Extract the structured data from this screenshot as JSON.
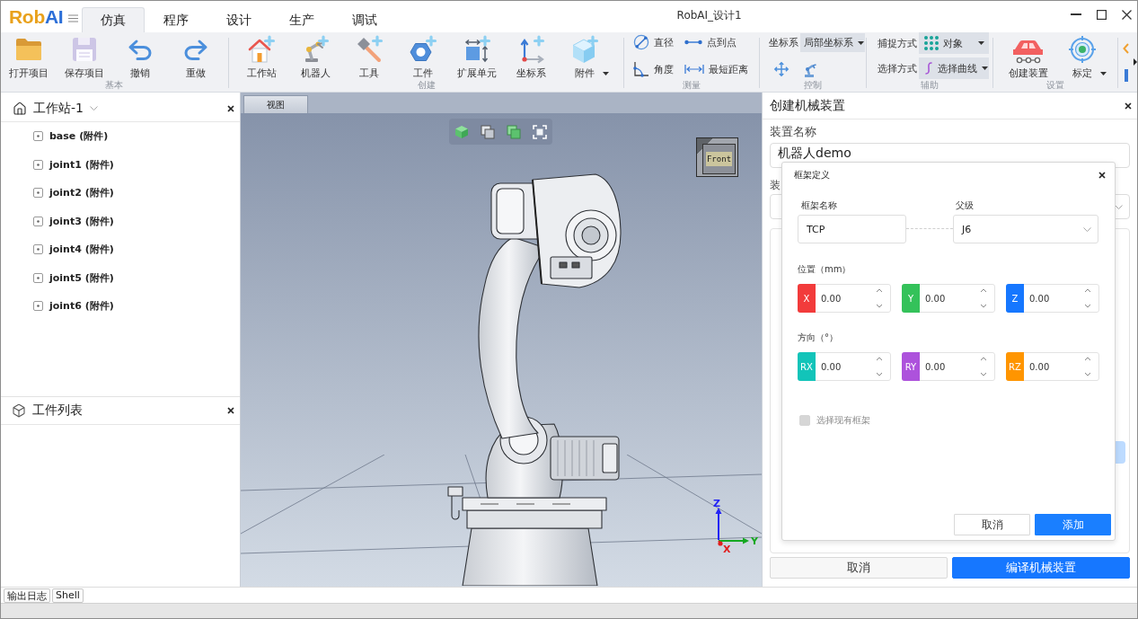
{
  "app": {
    "logo": [
      {
        "text": "Rob",
        "color": "#e9a11b"
      },
      {
        "text": "AI",
        "color": "#2c6fd8"
      }
    ],
    "title": "RobAI_设计1"
  },
  "menu_tabs": [
    {
      "label": "仿真",
      "selected": true
    },
    {
      "label": "程序",
      "selected": false
    },
    {
      "label": "设计",
      "selected": false
    },
    {
      "label": "生产",
      "selected": false
    },
    {
      "label": "调试",
      "selected": false
    }
  ],
  "ribbon": [
    {
      "kind": "buttons",
      "label": "基本",
      "buttons": [
        {
          "label": "打开项目",
          "kind": "plain"
        },
        {
          "label": "保存项目",
          "kind": "plain"
        },
        {
          "label": "撤销",
          "kind": "plain"
        },
        {
          "label": "重做",
          "kind": "plain"
        }
      ]
    },
    {
      "kind": "buttons",
      "label": "创建",
      "buttons": [
        {
          "label": "工作站",
          "kind": "plain"
        },
        {
          "label": "机器人",
          "kind": "plain"
        },
        {
          "label": "工具",
          "kind": "plain"
        },
        {
          "label": "工件",
          "kind": "plain"
        },
        {
          "label": "扩展单元",
          "kind": "plain"
        },
        {
          "label": "坐标系",
          "kind": "plain"
        },
        {
          "label": "附件",
          "kind": "menu"
        }
      ]
    },
    {
      "kind": "tools",
      "label": "测量",
      "buttons": [
        {
          "label": "直径"
        },
        {
          "label": "点到点"
        },
        {
          "label": "角度"
        },
        {
          "label": "最短距离"
        }
      ]
    },
    {
      "kind": "control",
      "label": "控制",
      "field": {
        "label": "坐标系",
        "value": "局部坐标系"
      }
    },
    {
      "kind": "selects",
      "label": "辅助",
      "fields": [
        {
          "label": "捕捉方式",
          "value": "对象"
        },
        {
          "label": "选择方式",
          "value": "选择曲线"
        }
      ]
    },
    {
      "kind": "buttons",
      "label": "设置",
      "buttons": [
        {
          "label": "创建装置",
          "kind": "plain"
        },
        {
          "label": "标定",
          "kind": "menu"
        }
      ]
    }
  ],
  "station_panel": {
    "title": "工作站-1",
    "items": [
      "base (附件)",
      "joint1 (附件)",
      "joint2 (附件)",
      "joint3 (附件)",
      "joint4 (附件)",
      "joint5 (附件)",
      "joint6 (附件)"
    ]
  },
  "parts_panel": {
    "title": "工件列表"
  },
  "viewport": {
    "tab": "视图",
    "view_cube": "Front",
    "axes": [
      {
        "label": "Z",
        "color": "#2323f5"
      },
      {
        "label": "Y",
        "color": "#14a821"
      },
      {
        "label": "X",
        "color": "#e01f1f"
      }
    ]
  },
  "mechanism_panel": {
    "title": "创建机械装置",
    "name_label": "装置名称",
    "name_value": "机器人demo",
    "second_label": "装",
    "buttons": [
      {
        "label": "取消",
        "kind": "secondary"
      },
      {
        "label": "编译机械装置",
        "kind": "primary"
      }
    ]
  },
  "frame_dialog": {
    "title": "框架定义",
    "frame_name": {
      "label": "框架名称",
      "value": "TCP"
    },
    "parent": {
      "label": "父级",
      "value": "J6"
    },
    "position": {
      "label": "位置（mm）",
      "fields": [
        {
          "axis": "X",
          "value": "0.00",
          "color": "#f23b3b"
        },
        {
          "axis": "Y",
          "value": "0.00",
          "color": "#34c25a"
        },
        {
          "axis": "Z",
          "value": "0.00",
          "color": "#1677ff"
        }
      ]
    },
    "orientation": {
      "label": "方向（°）",
      "fields": [
        {
          "axis": "RX",
          "value": "0.00",
          "color": "#12c4b9"
        },
        {
          "axis": "RY",
          "value": "0.00",
          "color": "#ad52dc"
        },
        {
          "axis": "RZ",
          "value": "0.00",
          "color": "#ff9500"
        }
      ]
    },
    "existing_frame": {
      "label": "选择现有框架",
      "checked": false,
      "disabled": true
    },
    "buttons": [
      {
        "label": "取消",
        "kind": "secondary"
      },
      {
        "label": "添加",
        "kind": "primary"
      }
    ]
  },
  "bottom_tabs": [
    "输出日志",
    "Shell"
  ]
}
